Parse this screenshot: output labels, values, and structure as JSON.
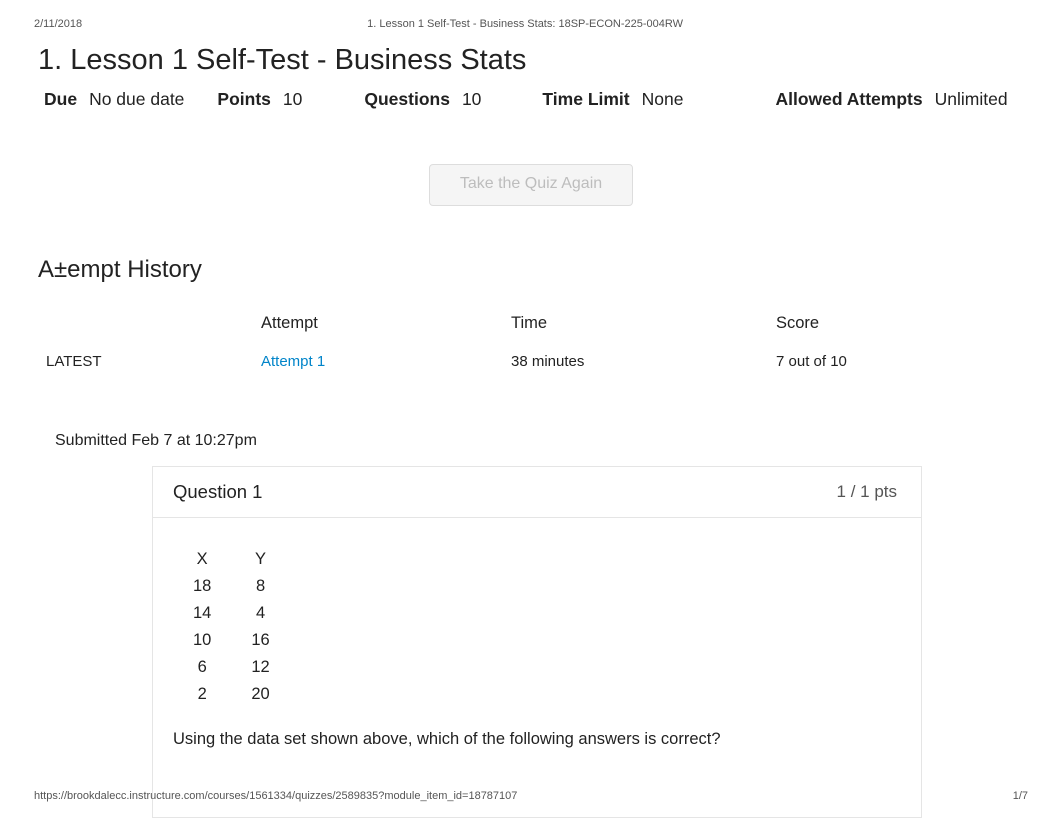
{
  "header": {
    "date": "2/11/2018",
    "doc_title": "1. Lesson 1 Self-Test - Business Stats: 18SP-ECON-225-004RW"
  },
  "page_title": "1. Lesson 1 Self-Test - Business Stats",
  "meta": {
    "due_label": "Due",
    "due_value": "No due date",
    "points_label": "Points",
    "points_value": "10",
    "questions_label": "Questions",
    "questions_value": "10",
    "time_limit_label": "Time Limit",
    "time_limit_value": "None",
    "allowed_attempts_label": "Allowed Attempts",
    "allowed_attempts_value": "Unlimited"
  },
  "take_quiz_label": "Take the Quiz Again",
  "attempt_history_heading": "A±empt History",
  "history": {
    "headers": {
      "blank": "",
      "attempt": "Attempt",
      "time": "Time",
      "score": "Score"
    },
    "rows": [
      {
        "latest": "LATEST",
        "attempt_label": "Attempt 1",
        "time": "38 minutes",
        "score": "7 out of 10"
      }
    ]
  },
  "submitted_text": "Submitted Feb 7 at 10:27pm",
  "question": {
    "title": "Question 1",
    "pts": "1 / 1 pts",
    "xy": {
      "head_x": "X",
      "head_y": "Y",
      "rows": [
        {
          "x": "18",
          "y": "8"
        },
        {
          "x": "14",
          "y": "4"
        },
        {
          "x": "10",
          "y": "16"
        },
        {
          "x": "6",
          "y": "12"
        },
        {
          "x": "2",
          "y": "20"
        }
      ]
    },
    "prompt": "Using the data set shown above, which of the following answers is correct?"
  },
  "footer": {
    "url": "https://brookdalecc.instructure.com/courses/1561334/quizzes/2589835?module_item_id=18787107",
    "page": "1/7"
  }
}
